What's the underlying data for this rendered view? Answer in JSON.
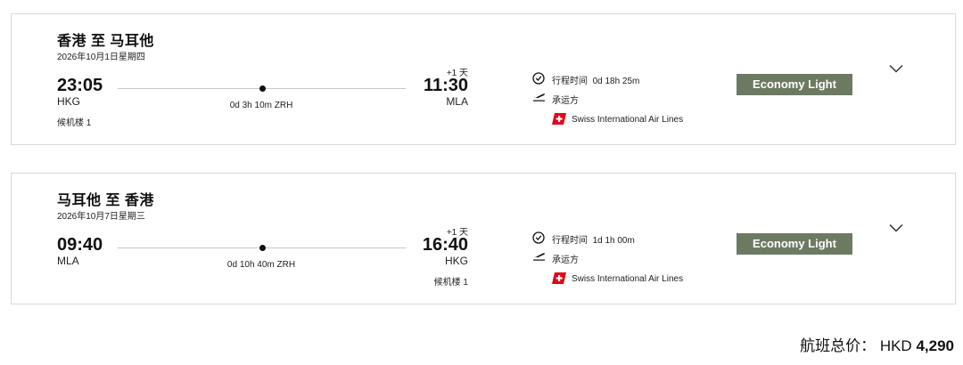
{
  "flights": [
    {
      "route": "香港 至 马耳他",
      "date": "2026年10月1日星期四",
      "departure": {
        "time": "23:05",
        "code": "HKG",
        "terminal": "候机楼 1"
      },
      "stop_info": "0d 3h 10m ZRH",
      "arrival": {
        "day_offset": "+1 天",
        "time": "11:30",
        "code": "MLA",
        "terminal": ""
      },
      "duration_label": "行程时间",
      "duration": "0d 18h 25m",
      "operator_label": "承运方",
      "airline": "Swiss International Air Lines",
      "fare": "Economy Light"
    },
    {
      "route": "马耳他 至 香港",
      "date": "2026年10月7日星期三",
      "departure": {
        "time": "09:40",
        "code": "MLA",
        "terminal": ""
      },
      "stop_info": "0d 10h 40m ZRH",
      "arrival": {
        "day_offset": "+1 天",
        "time": "16:40",
        "code": "HKG",
        "terminal": "候机楼 1"
      },
      "duration_label": "行程时间",
      "duration": "1d 1h 00m",
      "operator_label": "承运方",
      "airline": "Swiss International Air Lines",
      "fare": "Economy Light"
    }
  ],
  "total": {
    "label": "航班总价：",
    "currency": "HKD",
    "amount": "4,290"
  },
  "colors": {
    "fare_badge": "#6d7a62",
    "airline_red": "#e2001a",
    "border": "#d9d9d9"
  },
  "icons": [
    "clock-icon",
    "plane-takeoff-icon",
    "swiss-airline-logo",
    "chevron-down-icon"
  ]
}
